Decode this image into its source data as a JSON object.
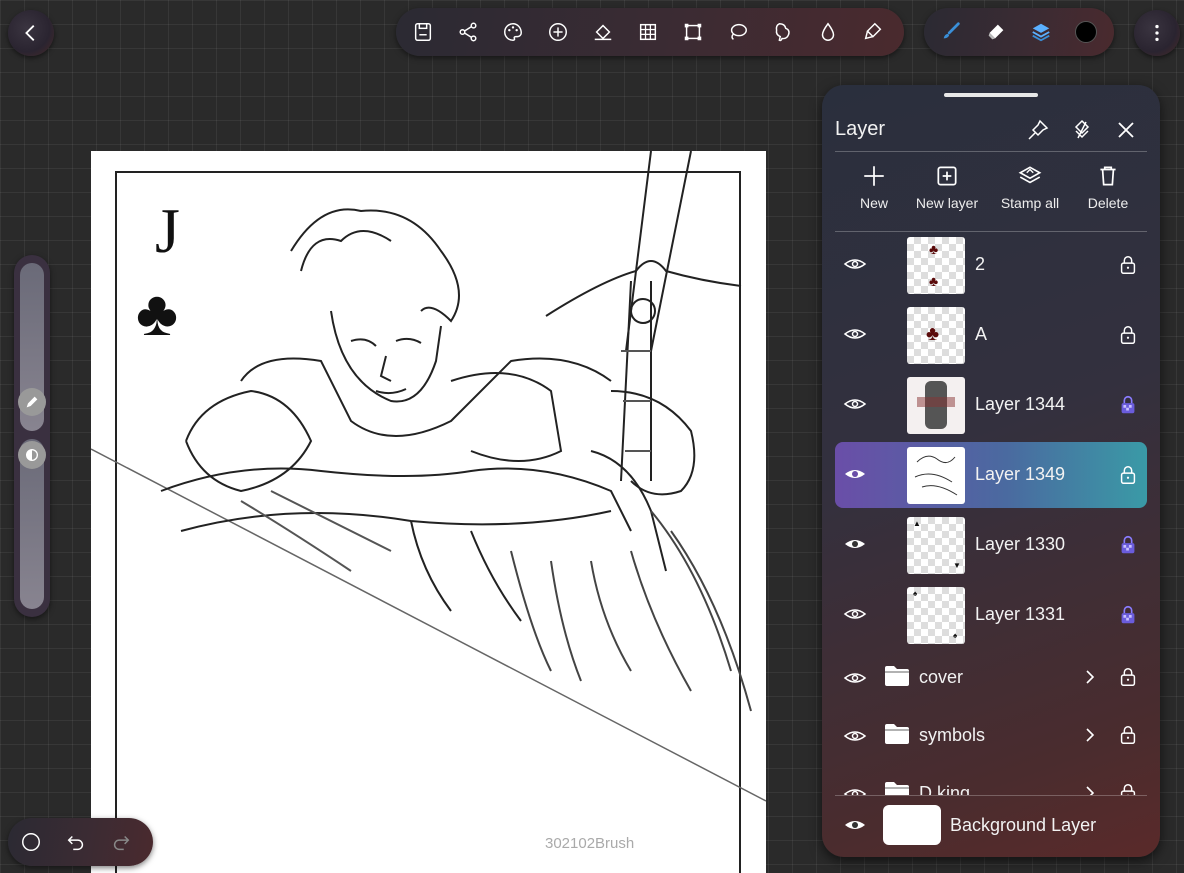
{
  "toolbar": {
    "icons": [
      "save-icon",
      "share-icon",
      "palette-icon",
      "add-icon",
      "fill-bucket-icon",
      "grid-transform-icon",
      "crop-icon",
      "lasso-icon",
      "liquify-icon",
      "blur-drop-icon",
      "smudge-icon"
    ],
    "tools": [
      "brush-icon",
      "eraser-icon",
      "layers-icon",
      "color-swatch-icon"
    ],
    "active_color": "#000000",
    "brush_color": "#3a8fd8"
  },
  "canvas": {
    "card_rank": "J",
    "card_suit": "♣",
    "watermark": "302102Brush"
  },
  "layer_panel": {
    "title": "Layer",
    "actions": [
      {
        "label": "New",
        "icon": "plus-icon"
      },
      {
        "label": "New layer",
        "icon": "new-layer-icon"
      },
      {
        "label": "Stamp all",
        "icon": "stamp-all-icon"
      },
      {
        "label": "Delete",
        "icon": "trash-icon"
      }
    ],
    "layers": [
      {
        "name": "2",
        "visible": false,
        "selected": false,
        "lock": "unlocked"
      },
      {
        "name": "A",
        "visible": false,
        "selected": false,
        "lock": "unlocked"
      },
      {
        "name": "Layer 1344",
        "visible": false,
        "selected": false,
        "lock": "alpha-locked"
      },
      {
        "name": "Layer 1349",
        "visible": true,
        "selected": true,
        "lock": "unlocked"
      },
      {
        "name": "Layer 1330",
        "visible": true,
        "selected": false,
        "lock": "alpha-locked"
      },
      {
        "name": "Layer 1331",
        "visible": false,
        "selected": false,
        "lock": "alpha-locked"
      }
    ],
    "folders": [
      {
        "name": "cover"
      },
      {
        "name": "symbols"
      },
      {
        "name": "D king"
      }
    ],
    "background_layer": {
      "name": "Background Layer",
      "visible": true
    }
  },
  "colors": {
    "selected_row_start": "#6a4ea8",
    "selected_row_end": "#3a9aa6",
    "alpha_lock": "#8a7cff"
  }
}
